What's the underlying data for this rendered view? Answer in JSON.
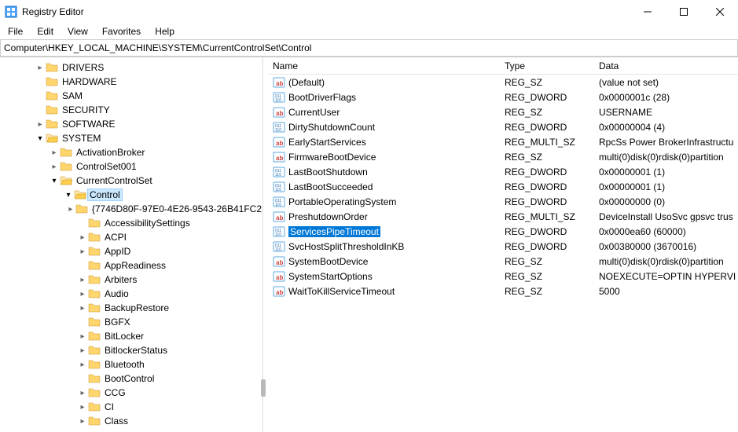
{
  "window": {
    "title": "Registry Editor"
  },
  "menu": {
    "file": "File",
    "edit": "Edit",
    "view": "View",
    "favorites": "Favorites",
    "help": "Help"
  },
  "address": "Computer\\HKEY_LOCAL_MACHINE\\SYSTEM\\CurrentControlSet\\Control",
  "columns": {
    "name": "Name",
    "type": "Type",
    "data": "Data"
  },
  "tree": [
    {
      "indent": 2,
      "twisty": "closed",
      "label": "DRIVERS",
      "open": false
    },
    {
      "indent": 2,
      "twisty": "none",
      "label": "HARDWARE",
      "open": false
    },
    {
      "indent": 2,
      "twisty": "none",
      "label": "SAM",
      "open": false
    },
    {
      "indent": 2,
      "twisty": "none",
      "label": "SECURITY",
      "open": false
    },
    {
      "indent": 2,
      "twisty": "closed",
      "label": "SOFTWARE",
      "open": false
    },
    {
      "indent": 2,
      "twisty": "open",
      "label": "SYSTEM",
      "open": true
    },
    {
      "indent": 3,
      "twisty": "closed",
      "label": "ActivationBroker",
      "open": false
    },
    {
      "indent": 3,
      "twisty": "closed",
      "label": "ControlSet001",
      "open": false
    },
    {
      "indent": 3,
      "twisty": "open",
      "label": "CurrentControlSet",
      "open": true
    },
    {
      "indent": 4,
      "twisty": "open",
      "label": "Control",
      "open": true,
      "selected": true
    },
    {
      "indent": 5,
      "twisty": "closed",
      "label": "{7746D80F-97E0-4E26-9543-26B41FC2",
      "open": false
    },
    {
      "indent": 5,
      "twisty": "none",
      "label": "AccessibilitySettings",
      "open": false
    },
    {
      "indent": 5,
      "twisty": "closed",
      "label": "ACPI",
      "open": false
    },
    {
      "indent": 5,
      "twisty": "closed",
      "label": "AppID",
      "open": false
    },
    {
      "indent": 5,
      "twisty": "none",
      "label": "AppReadiness",
      "open": false
    },
    {
      "indent": 5,
      "twisty": "closed",
      "label": "Arbiters",
      "open": false
    },
    {
      "indent": 5,
      "twisty": "closed",
      "label": "Audio",
      "open": false
    },
    {
      "indent": 5,
      "twisty": "closed",
      "label": "BackupRestore",
      "open": false
    },
    {
      "indent": 5,
      "twisty": "none",
      "label": "BGFX",
      "open": false
    },
    {
      "indent": 5,
      "twisty": "closed",
      "label": "BitLocker",
      "open": false
    },
    {
      "indent": 5,
      "twisty": "closed",
      "label": "BitlockerStatus",
      "open": false
    },
    {
      "indent": 5,
      "twisty": "closed",
      "label": "Bluetooth",
      "open": false
    },
    {
      "indent": 5,
      "twisty": "none",
      "label": "BootControl",
      "open": false
    },
    {
      "indent": 5,
      "twisty": "closed",
      "label": "CCG",
      "open": false
    },
    {
      "indent": 5,
      "twisty": "closed",
      "label": "CI",
      "open": false
    },
    {
      "indent": 5,
      "twisty": "closed",
      "label": "Class",
      "open": false
    }
  ],
  "values": [
    {
      "icon": "str",
      "name": "(Default)",
      "type": "REG_SZ",
      "data": "(value not set)"
    },
    {
      "icon": "bin",
      "name": "BootDriverFlags",
      "type": "REG_DWORD",
      "data": "0x0000001c (28)"
    },
    {
      "icon": "str",
      "name": "CurrentUser",
      "type": "REG_SZ",
      "data": "USERNAME"
    },
    {
      "icon": "bin",
      "name": "DirtyShutdownCount",
      "type": "REG_DWORD",
      "data": "0x00000004 (4)"
    },
    {
      "icon": "str",
      "name": "EarlyStartServices",
      "type": "REG_MULTI_SZ",
      "data": "RpcSs Power BrokerInfrastructu"
    },
    {
      "icon": "str",
      "name": "FirmwareBootDevice",
      "type": "REG_SZ",
      "data": "multi(0)disk(0)rdisk(0)partition"
    },
    {
      "icon": "bin",
      "name": "LastBootShutdown",
      "type": "REG_DWORD",
      "data": "0x00000001 (1)"
    },
    {
      "icon": "bin",
      "name": "LastBootSucceeded",
      "type": "REG_DWORD",
      "data": "0x00000001 (1)"
    },
    {
      "icon": "bin",
      "name": "PortableOperatingSystem",
      "type": "REG_DWORD",
      "data": "0x00000000 (0)"
    },
    {
      "icon": "str",
      "name": "PreshutdownOrder",
      "type": "REG_MULTI_SZ",
      "data": "DeviceInstall UsoSvc gpsvc trus"
    },
    {
      "icon": "bin",
      "name": "ServicesPipeTimeout",
      "type": "REG_DWORD",
      "data": "0x0000ea60 (60000)",
      "selected": true
    },
    {
      "icon": "bin",
      "name": "SvcHostSplitThresholdInKB",
      "type": "REG_DWORD",
      "data": "0x00380000 (3670016)"
    },
    {
      "icon": "str",
      "name": "SystemBootDevice",
      "type": "REG_SZ",
      "data": "multi(0)disk(0)rdisk(0)partition"
    },
    {
      "icon": "str",
      "name": "SystemStartOptions",
      "type": "REG_SZ",
      "data": " NOEXECUTE=OPTIN  HYPERVI"
    },
    {
      "icon": "str",
      "name": "WaitToKillServiceTimeout",
      "type": "REG_SZ",
      "data": "5000"
    }
  ]
}
